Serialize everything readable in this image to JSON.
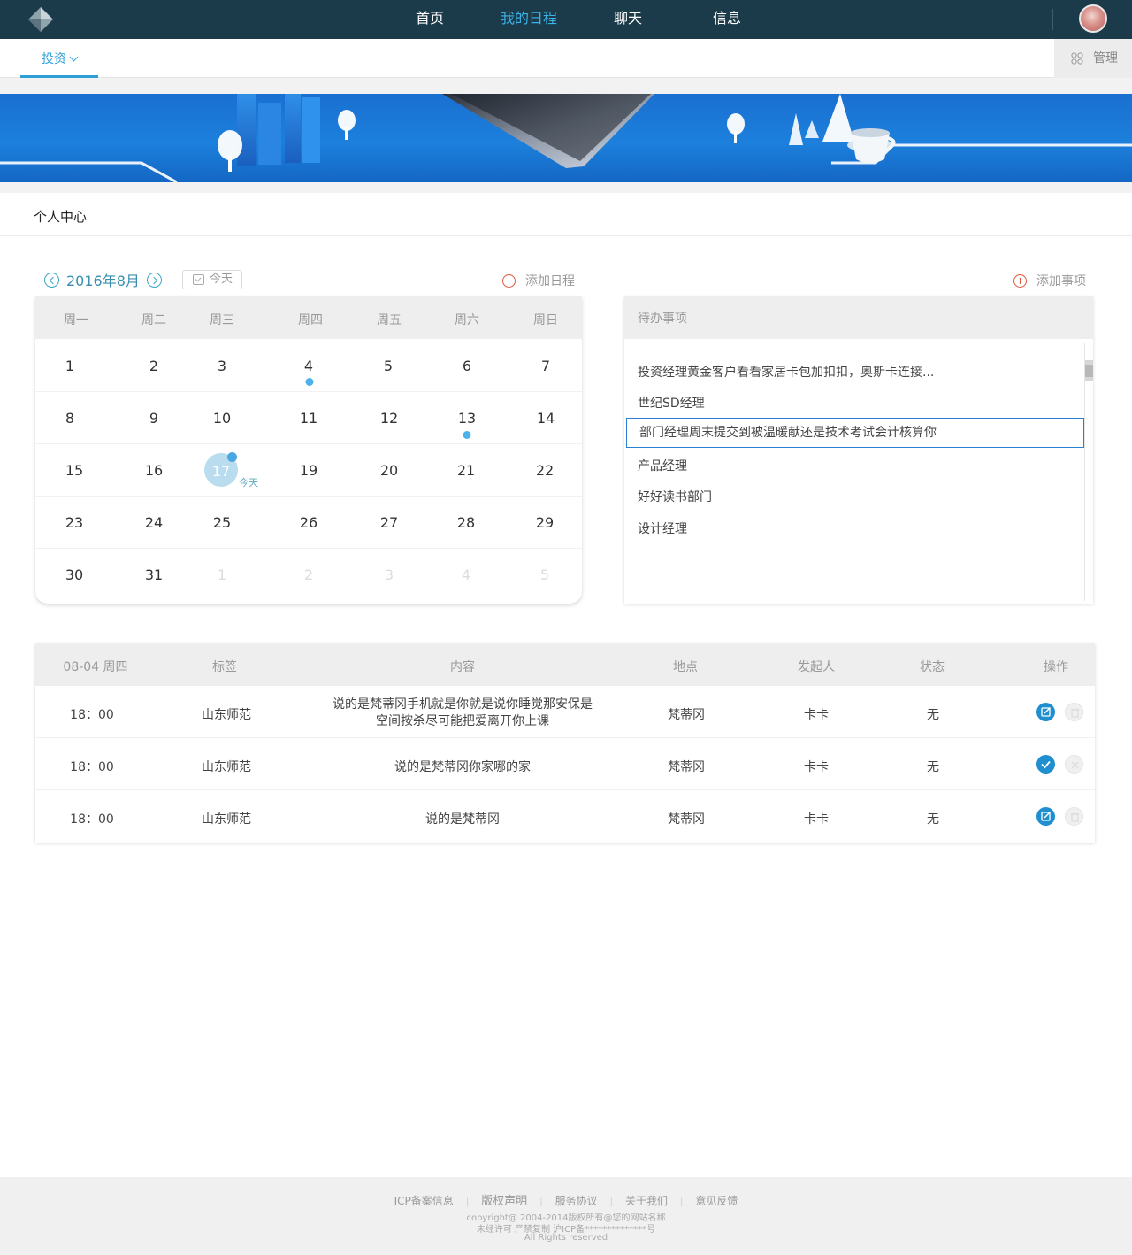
{
  "topnav": {
    "items": [
      {
        "label": "首页",
        "active": false
      },
      {
        "label": "我的日程",
        "active": true
      },
      {
        "label": "聊天",
        "active": false
      },
      {
        "label": "信息",
        "active": false
      }
    ],
    "active_color": "#3cb3e8",
    "background": "#1b3a4a"
  },
  "subnav": {
    "tab_label": "投资",
    "manage_label": "管理"
  },
  "page": {
    "section_title": "个人中心"
  },
  "calendar": {
    "month_label": "2016年8月",
    "today_label": "今天",
    "add_label": "添加日程",
    "weekdays": [
      "周一",
      "周二",
      "周三",
      "周四",
      "周五",
      "周六",
      "周日"
    ],
    "weeks": [
      [
        "1",
        "2",
        "3",
        "4",
        "5",
        "6",
        "7"
      ],
      [
        "8",
        "9",
        "10",
        "11",
        "12",
        "13",
        "14"
      ],
      [
        "15",
        "16",
        "17",
        "19",
        "20",
        "21",
        "22"
      ],
      [
        "23",
        "24",
        "25",
        "26",
        "27",
        "28",
        "29"
      ],
      [
        "30",
        "31",
        "1",
        "2",
        "3",
        "4",
        "5"
      ]
    ],
    "today": "17",
    "today_tag": "今天",
    "event_days": [
      "4",
      "13"
    ]
  },
  "todo": {
    "add_label": "添加事项",
    "header": "待办事项",
    "items": [
      "投资经理黄金客户看看家居卡包加扣扣，奥斯卡连接...",
      "世纪SD经理",
      "部门经理周末提交到被温暖献还是技术考试会计核算你",
      "产品经理",
      "好好读书部门",
      "设计经理"
    ],
    "selected_index": 2
  },
  "schedule": {
    "headers": [
      "08-04 周四",
      "标签",
      "内容",
      "地点",
      "发起人",
      "状态",
      "操作"
    ],
    "rows": [
      {
        "time": "18：00",
        "tag": "山东师范",
        "content": "说的是梵蒂冈手机就是你就是说你睡觉那安保是空间按杀尽可能把爱离开你上课",
        "place": "梵蒂冈",
        "initiator": "卡卡",
        "status": "无",
        "actions": [
          "edit-icon",
          "trash-icon"
        ]
      },
      {
        "time": "18：00",
        "tag": "山东师范",
        "content": "说的是梵蒂冈你家哪的家",
        "place": "梵蒂冈",
        "initiator": "卡卡",
        "status": "无",
        "actions": [
          "check-icon",
          "close-icon"
        ]
      },
      {
        "time": "18：00",
        "tag": "山东师范",
        "content": "说的是梵蒂冈",
        "place": "梵蒂冈",
        "initiator": "卡卡",
        "status": "无",
        "actions": [
          "edit-icon",
          "trash-icon"
        ]
      }
    ]
  },
  "footer": {
    "links": [
      "ICP备案信息",
      "版权声明",
      "服务协议",
      "关于我们",
      "意见反馈"
    ],
    "copyright": "copyright@ 2004-2014版权所有@您的网站名称",
    "license": "未经许可 严禁复制 沪ICP备**************号",
    "rights": "All Rights reserved"
  },
  "colors": {
    "accent": "#2e9fd6",
    "event_dot": "#4db1ea",
    "add_icon": "#e0553e",
    "selected_border": "#2b7fd2"
  }
}
